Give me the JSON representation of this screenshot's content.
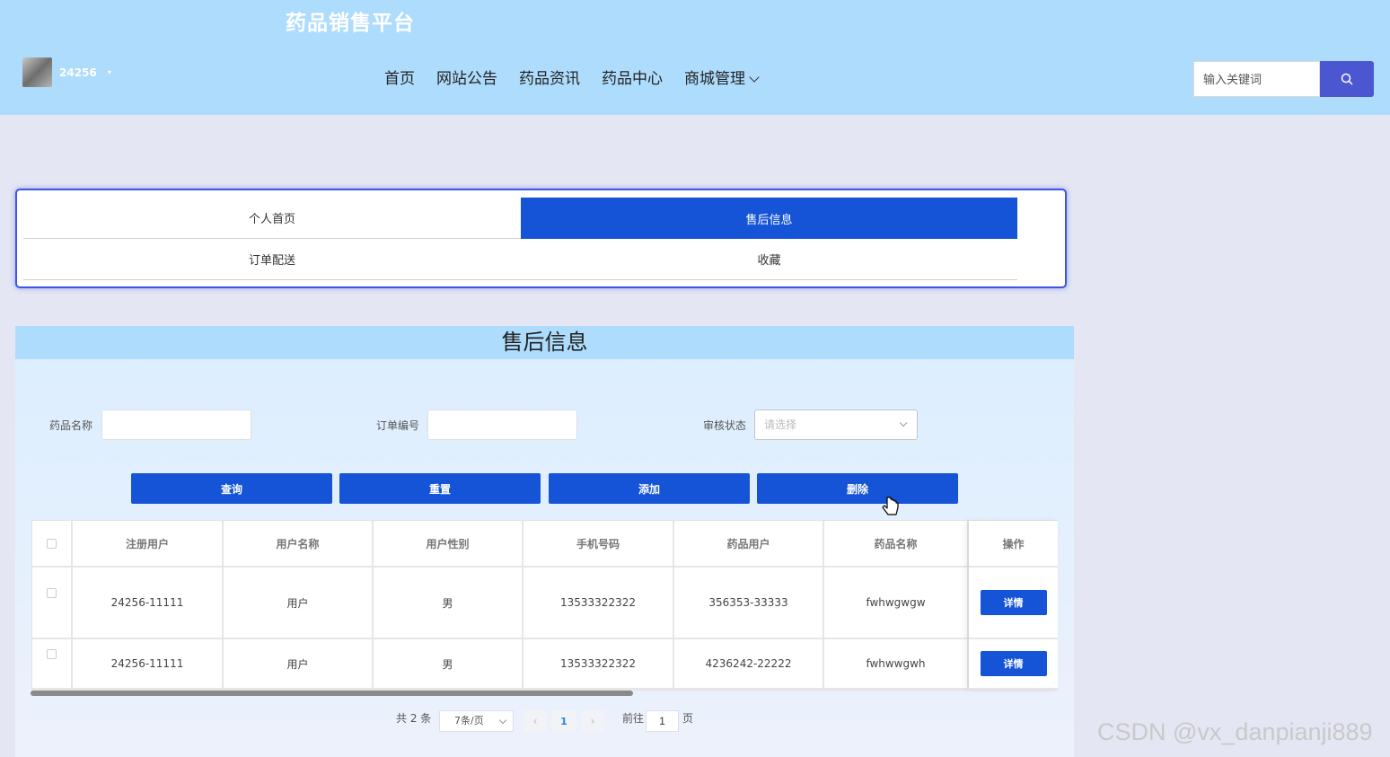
{
  "header": {
    "site_title": "药品销售平台",
    "username": "24256",
    "nav": [
      "首页",
      "网站公告",
      "药品资讯",
      "药品中心",
      "商城管理"
    ],
    "search_placeholder": "输入关键词",
    "colors": {
      "header_bg": "#aedcfd",
      "search_button": "#4b57d1"
    }
  },
  "tab_menu": {
    "tabs": [
      "个人首页",
      "售后信息",
      "订单配送",
      "收藏"
    ],
    "active": "售后信息"
  },
  "panel": {
    "title": "售后信息",
    "filters": {
      "drug_name_label": "药品名称",
      "order_no_label": "订单编号",
      "review_status_label": "审核状态",
      "review_status_placeholder": "请选择"
    },
    "buttons": [
      "查询",
      "重置",
      "添加",
      "删除"
    ],
    "table": {
      "columns": [
        "注册用户",
        "用户名称",
        "用户性别",
        "手机号码",
        "药品用户",
        "药品名称",
        "操作"
      ],
      "rows": [
        [
          "24256-11111",
          "用户",
          "男",
          "13533322322",
          "356353-33333",
          "fwhwgwgw"
        ],
        [
          "24256-11111",
          "用户",
          "男",
          "13533322322",
          "4236242-22222",
          "fwhwwgwh"
        ]
      ],
      "detail_label": "详情"
    },
    "pagination": {
      "total": "共 2 条",
      "page_size": "7条/页",
      "current_page": "1",
      "goto_label": "前往",
      "goto_value": "1",
      "page_suffix": "页"
    },
    "colors": {
      "primary": "#1554d6"
    }
  },
  "watermark": "CSDN @vx_danpianji889"
}
